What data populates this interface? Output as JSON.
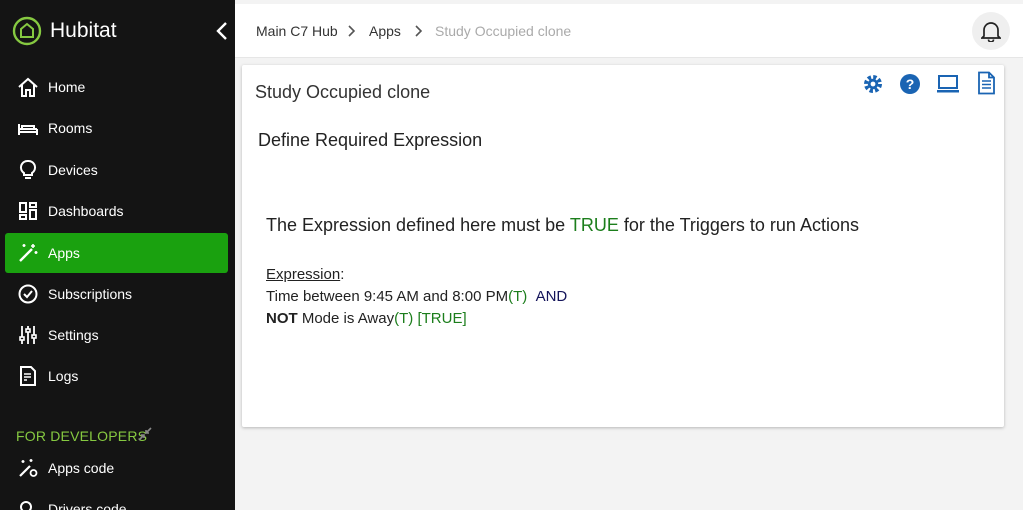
{
  "brand": {
    "name": "Hubitat"
  },
  "sidebar": {
    "items": [
      {
        "label": "Home",
        "icon": "home-icon"
      },
      {
        "label": "Rooms",
        "icon": "bed-icon"
      },
      {
        "label": "Devices",
        "icon": "bulb-icon"
      },
      {
        "label": "Dashboards",
        "icon": "dashboard-icon"
      },
      {
        "label": "Apps",
        "icon": "magic-wand-icon",
        "active": true
      },
      {
        "label": "Subscriptions",
        "icon": "check-circle-icon"
      },
      {
        "label": "Settings",
        "icon": "sliders-icon"
      },
      {
        "label": "Logs",
        "icon": "log-file-icon"
      }
    ],
    "developers_heading": "FOR DEVELOPERS",
    "dev_items": [
      {
        "label": "Apps code",
        "icon": "wand-gear-icon"
      },
      {
        "label": "Drivers code",
        "icon": "driver-gear-icon"
      }
    ]
  },
  "breadcrumb": [
    "Main C7 Hub",
    "Apps",
    "Study Occupied clone"
  ],
  "card": {
    "title": "Study Occupied clone",
    "tools": [
      "gear-icon",
      "help-icon",
      "laptop-icon",
      "document-icon"
    ],
    "section_title": "Define Required Expression",
    "intro_prefix": "The Expression defined here must be ",
    "intro_true": "TRUE",
    "intro_suffix": " for the Triggers to run Actions",
    "expression_label": "Expression",
    "expression_colon": ":",
    "line1_text": "Time between 9:45 AM and 8:00 PM",
    "line1_flag": "(T)",
    "line1_op": "AND",
    "line2_not": "NOT",
    "line2_text": " Mode is Away",
    "line2_flag": "(T)",
    "line2_result": "[TRUE]"
  },
  "colors": {
    "sidebar_bg": "#141414",
    "active": "#1aa10f",
    "accent_blue": "#1a64b3",
    "developers_green": "#86c941",
    "true_green": "#1c7e1c"
  }
}
